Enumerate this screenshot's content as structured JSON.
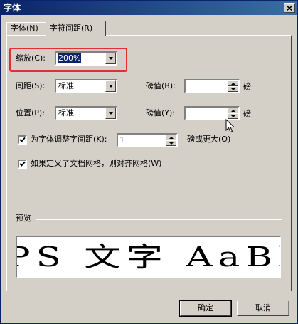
{
  "window": {
    "title": "字体"
  },
  "tabs": [
    {
      "label": "字体(N)",
      "active": false
    },
    {
      "label": "字符间距(R)",
      "active": true
    }
  ],
  "form": {
    "scale": {
      "label": "缩放(C):",
      "value": "200%"
    },
    "spacing": {
      "label": "间距(S):",
      "value": "标准",
      "pt_label": "磅值(B):",
      "pt_value": "",
      "unit": "磅"
    },
    "position": {
      "label": "位置(P):",
      "value": "标准",
      "pt_label": "磅值(Y):",
      "pt_value": "",
      "unit": "磅"
    },
    "kerning": {
      "checked": true,
      "label": "为字体调整字间距(K):",
      "value": "1",
      "suffix": "磅或更大(O)"
    },
    "grid": {
      "checked": true,
      "label": "如果定义了文档网格，则对齐网格(W)"
    }
  },
  "preview": {
    "label": "预览",
    "sample_text": "PS 文字 AaBb"
  },
  "buttons": {
    "ok": "确定",
    "cancel": "取消"
  },
  "colors": {
    "dialog_bg": "#d4d0c8",
    "titlebar": "#0a246a",
    "highlight": "#e03030",
    "selection": "#0a246a"
  }
}
